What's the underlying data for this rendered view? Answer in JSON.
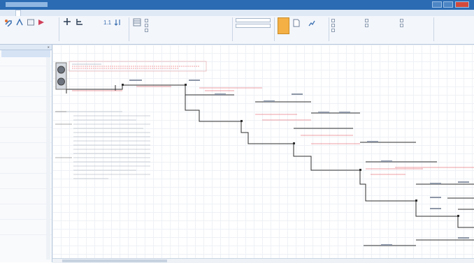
{
  "window": {
    "title": "",
    "controls": [
      "minimize",
      "maximize",
      "close"
    ]
  },
  "tabs": [
    "",
    "",
    "",
    "",
    ""
  ],
  "ribbon": {
    "groups": [
      "",
      "",
      "",
      "",
      ""
    ],
    "checkboxes": [
      "",
      "",
      "",
      "",
      "",
      "",
      "",
      "",
      "",
      "",
      "",
      ""
    ],
    "selects": [
      "",
      ""
    ]
  },
  "sidebar": {
    "header": "",
    "selected_item": "",
    "rows": 14
  },
  "diagram": {
    "unit_labels": [],
    "branch_labels": [],
    "annotation_lines": [],
    "note_red": []
  },
  "colors": {
    "accent": "#2b6bb3",
    "pipe": "#333333",
    "highlight": "#e0404a",
    "selected_button": "#f4b045"
  }
}
